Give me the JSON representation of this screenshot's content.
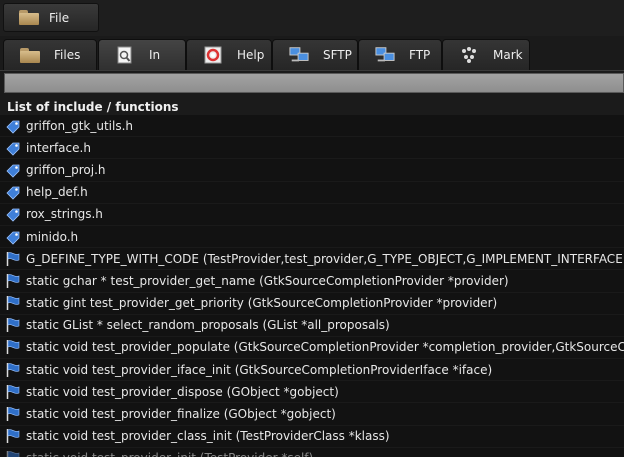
{
  "menubar": {
    "file_label": "File"
  },
  "tabs": [
    {
      "label": "Files",
      "icon": "folder-icon"
    },
    {
      "label": "In",
      "icon": "document-magnifier-icon"
    },
    {
      "label": "Help",
      "icon": "help-lifebuoy-icon"
    },
    {
      "label": "SFTP",
      "icon": "network-computers-icon"
    },
    {
      "label": "FTP",
      "icon": "network-computers-icon"
    },
    {
      "label": "Mark",
      "icon": "bookmark-dots-icon"
    }
  ],
  "search": {
    "value": ""
  },
  "list": {
    "header": "List of include / functions",
    "items": [
      {
        "text": "griffon_gtk_utils.h",
        "kind": "include"
      },
      {
        "text": "interface.h",
        "kind": "include"
      },
      {
        "text": "griffon_proj.h",
        "kind": "include"
      },
      {
        "text": "help_def.h",
        "kind": "include"
      },
      {
        "text": "rox_strings.h",
        "kind": "include"
      },
      {
        "text": "minido.h",
        "kind": "include"
      },
      {
        "text": "G_DEFINE_TYPE_WITH_CODE (TestProvider,test_provider,G_TYPE_OBJECT,G_IMPLEMENT_INTERFACE",
        "kind": "function"
      },
      {
        "text": "static gchar * test_provider_get_name (GtkSourceCompletionProvider *provider)",
        "kind": "function"
      },
      {
        "text": "static gint test_provider_get_priority (GtkSourceCompletionProvider *provider)",
        "kind": "function"
      },
      {
        "text": "static GList * select_random_proposals (GList *all_proposals)",
        "kind": "function"
      },
      {
        "text": "static void test_provider_populate (GtkSourceCompletionProvider *completion_provider,GtkSourceC",
        "kind": "function"
      },
      {
        "text": "static void test_provider_iface_init (GtkSourceCompletionProviderIface *iface)",
        "kind": "function"
      },
      {
        "text": "static void test_provider_dispose (GObject *gobject)",
        "kind": "function"
      },
      {
        "text": "static void test_provider_finalize (GObject *gobject)",
        "kind": "function"
      },
      {
        "text": "static void test_provider_class_init (TestProviderClass *klass)",
        "kind": "function"
      },
      {
        "text": "static void test_provider_init (TestProvider *self)",
        "kind": "function"
      }
    ]
  },
  "colors": {
    "include_icon": "#3f7fd8",
    "function_icon": "#2f6fc8"
  }
}
